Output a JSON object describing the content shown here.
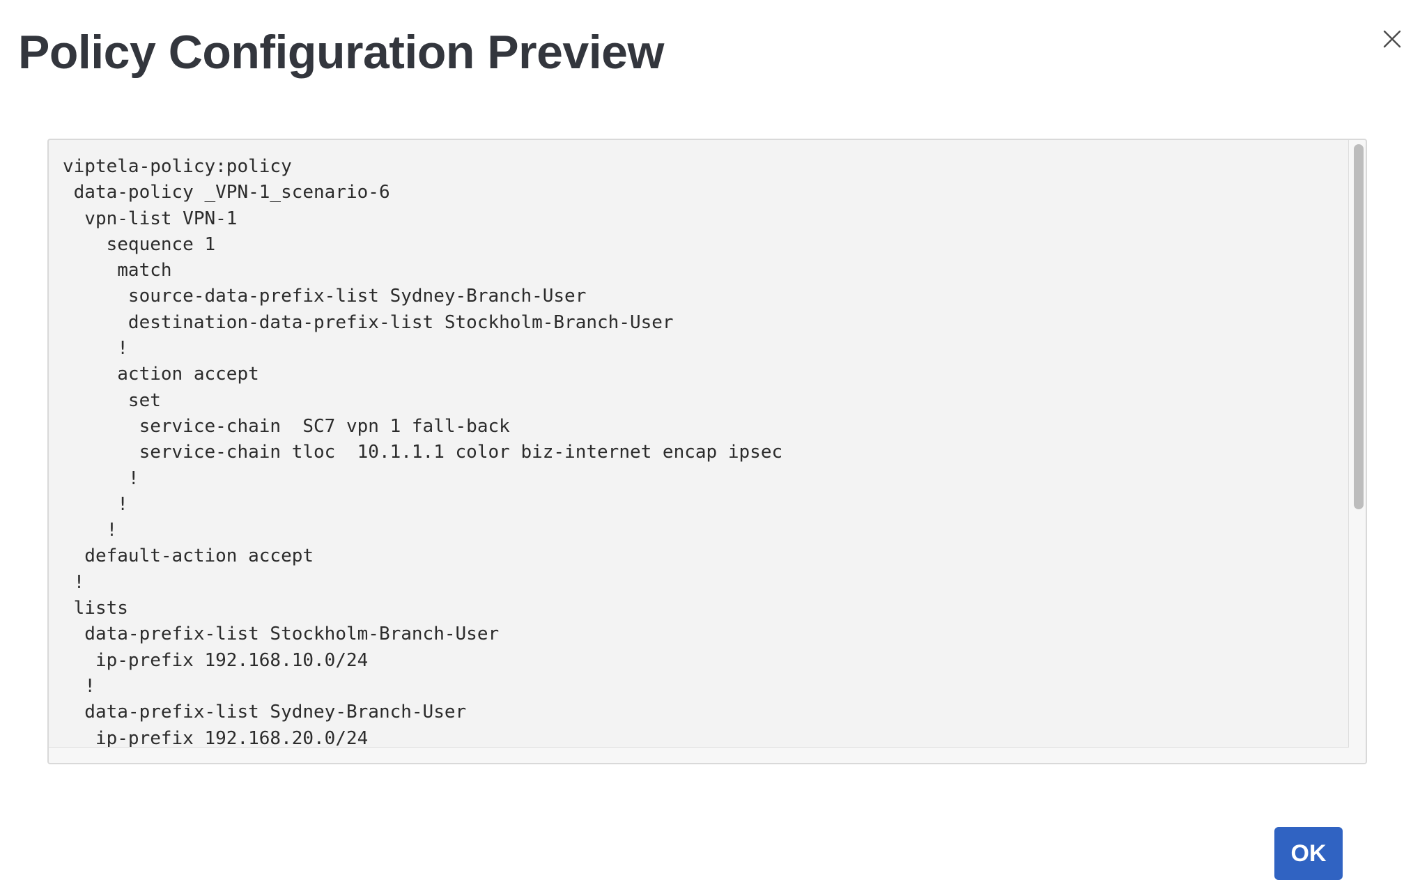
{
  "modal": {
    "title": "Policy Configuration Preview",
    "close_icon": "close-icon",
    "ok_label": "OK",
    "accent_color": "#3063c2"
  },
  "code": {
    "lines": [
      "viptela-policy:policy",
      " data-policy _VPN-1_scenario-6",
      "  vpn-list VPN-1",
      "    sequence 1",
      "     match",
      "      source-data-prefix-list Sydney-Branch-User",
      "      destination-data-prefix-list Stockholm-Branch-User",
      "     !",
      "     action accept",
      "      set",
      "       service-chain  SC7 vpn 1 fall-back",
      "       service-chain tloc  10.1.1.1 color biz-internet encap ipsec",
      "      !",
      "     !",
      "    !",
      "  default-action accept",
      " !",
      " lists",
      "  data-prefix-list Stockholm-Branch-User",
      "   ip-prefix 192.168.10.0/24",
      "  !",
      "  data-prefix-list Sydney-Branch-User",
      "   ip-prefix 192.168.20.0/24"
    ]
  }
}
